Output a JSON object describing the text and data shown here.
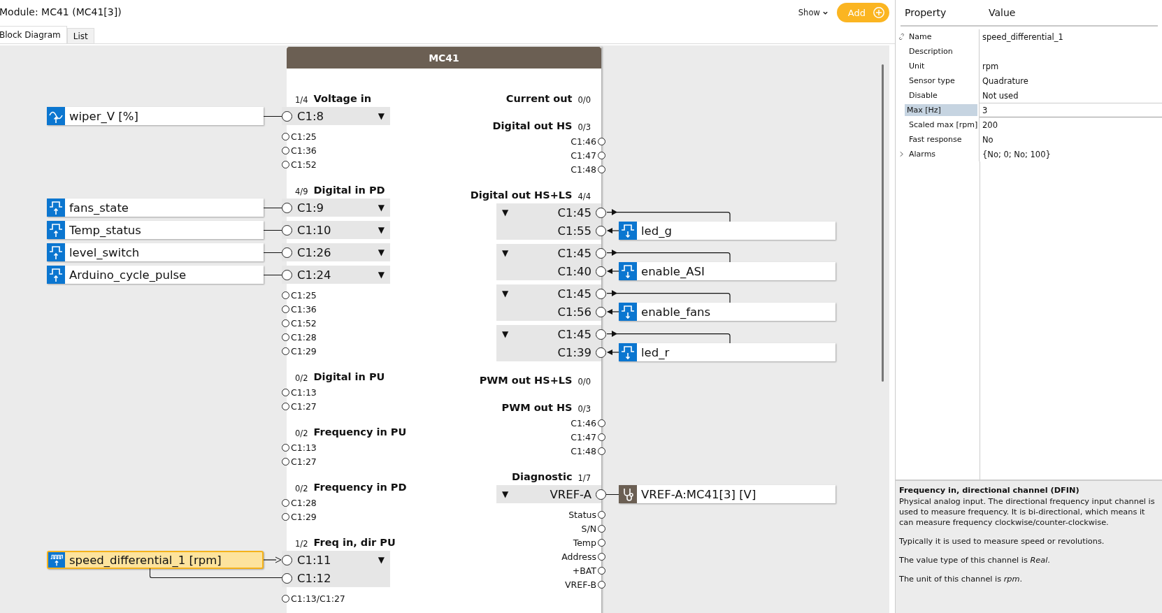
{
  "module_title": "Module: MC41 (MC41[3])",
  "tabs": [
    {
      "label": "Block Diagram",
      "selected": true
    },
    {
      "label": "List",
      "selected": false
    }
  ],
  "toolbar": {
    "show": "Show",
    "add": "Add"
  },
  "block": {
    "title": "MC41",
    "inputs": [
      {
        "count": "1/4",
        "name": "Voltage in",
        "connections": [
          {
            "toggle": "▼",
            "pins": [
              "C1:8"
            ],
            "signal": "wiper_V [%]",
            "kind": "analog",
            "selected": false
          }
        ],
        "free_pins": [
          "C1:25",
          "C1:36",
          "C1:52"
        ]
      },
      {
        "count": "4/9",
        "name": "Digital in PD",
        "connections": [
          {
            "toggle": "▼",
            "pins": [
              "C1:9"
            ],
            "signal": "fans_state",
            "kind": "digital",
            "selected": false
          },
          {
            "toggle": "▼",
            "pins": [
              "C1:10"
            ],
            "signal": "Temp_status",
            "kind": "digital",
            "selected": false
          },
          {
            "toggle": "▼",
            "pins": [
              "C1:26"
            ],
            "signal": "level_switch",
            "kind": "digital",
            "selected": false
          },
          {
            "toggle": "▼",
            "pins": [
              "C1:24"
            ],
            "signal": "Arduino_cycle_pulse",
            "kind": "digital",
            "selected": false
          }
        ],
        "free_pins": [
          "C1:25",
          "C1:36",
          "C1:52",
          "C1:28",
          "C1:29"
        ]
      },
      {
        "count": "0/2",
        "name": "Digital in PU",
        "free_pins": [
          "C1:13",
          "C1:27"
        ]
      },
      {
        "count": "0/2",
        "name": "Frequency in PU",
        "free_pins": [
          "C1:13",
          "C1:27"
        ]
      },
      {
        "count": "0/2",
        "name": "Frequency in PD",
        "free_pins": [
          "C1:28",
          "C1:29"
        ]
      },
      {
        "count": "1/2",
        "name": "Freq in, dir PU",
        "connections": [
          {
            "toggle": "▼",
            "pins": [
              "C1:11",
              "C1:12"
            ],
            "signal": "speed_differential_1 [rpm]",
            "kind": "frequency",
            "selected": true
          }
        ],
        "free_pins": [
          "C1:13/C1:27"
        ]
      }
    ],
    "outputs": [
      {
        "name": "Current out",
        "count": "0/0"
      },
      {
        "name": "Digital out HS",
        "count": "0/3",
        "free_pins": [
          "C1:46",
          "C1:47",
          "C1:48"
        ]
      },
      {
        "name": "Digital out HS+LS",
        "count": "4/4",
        "connections": [
          {
            "toggle": "▼",
            "pins": [
              "C1:45",
              "C1:55"
            ],
            "signal": "led_g",
            "kind": "digital",
            "selected": false
          },
          {
            "toggle": "▼",
            "pins": [
              "C1:45",
              "C1:40"
            ],
            "signal": "enable_ASI",
            "kind": "digital",
            "selected": false
          },
          {
            "toggle": "▼",
            "pins": [
              "C1:45",
              "C1:56"
            ],
            "signal": "enable_fans",
            "kind": "digital",
            "selected": false
          },
          {
            "toggle": "▼",
            "pins": [
              "C1:45",
              "C1:39"
            ],
            "signal": "led_r",
            "kind": "digital",
            "selected": false
          }
        ]
      },
      {
        "name": "PWM out HS+LS",
        "count": "0/0"
      },
      {
        "name": "PWM out HS",
        "count": "0/3",
        "free_pins": [
          "C1:46",
          "C1:47",
          "C1:48"
        ]
      },
      {
        "name": "Diagnostic",
        "count": "1/7",
        "connections": [
          {
            "toggle": "▼",
            "pins": [
              "VREF-A"
            ],
            "signal": "VREF-A:MC41[3] [V]",
            "kind": "diagnostic",
            "selected": false
          }
        ],
        "free_pins": [
          "Status",
          "S/N",
          "Temp",
          "Address",
          "+BAT",
          "VREF-B"
        ]
      }
    ]
  },
  "properties": {
    "columns": [
      "Property",
      "Value"
    ],
    "rows": [
      {
        "name": "Name",
        "value": "speed_differential_1",
        "kind": "linked",
        "selected": false
      },
      {
        "name": "Description",
        "kind": "plain",
        "selected": false
      },
      {
        "name": "Unit",
        "value": "rpm",
        "kind": "plain",
        "selected": false
      },
      {
        "name": "Sensor type",
        "value": "Quadrature",
        "kind": "plain",
        "selected": false
      },
      {
        "name": "Disable",
        "value": "Not used",
        "kind": "plain",
        "selected": false
      },
      {
        "name": "Max [Hz]",
        "value": "3",
        "kind": "plain",
        "selected": true
      },
      {
        "name": "Scaled max [rpm]",
        "value": "200",
        "kind": "plain",
        "selected": false
      },
      {
        "name": "Fast response",
        "value": "No",
        "kind": "plain",
        "selected": false
      },
      {
        "name": "Alarms",
        "value": "{No; 0; No; 100}",
        "kind": "expandable",
        "selected": false
      }
    ]
  },
  "description": {
    "title": "Frequency in, directional channel (DFIN)",
    "paragraphs": [
      "Physical analog input. The directional frequency input channel is used to measure frequency. It is bi-directional, which means it can measure frequency clockwise/counter-clockwise.",
      "Typically it is used to measure speed or revolutions.",
      "The value type of this channel is *Real*.",
      "The unit of this channel is *rpm*."
    ]
  }
}
